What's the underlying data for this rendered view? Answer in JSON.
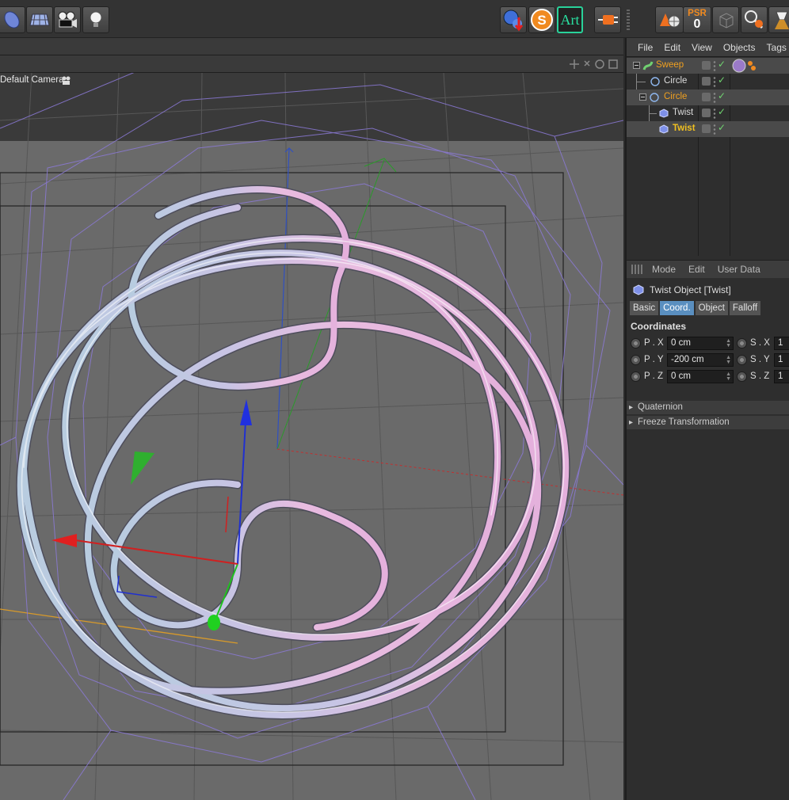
{
  "viewport": {
    "camera_label": "Default Camera"
  },
  "toolbar": {
    "psr_label": "PSR",
    "psr_value": "0",
    "art_label": "Art",
    "s_label": "S"
  },
  "object_manager": {
    "menu": [
      "File",
      "Edit",
      "View",
      "Objects",
      "Tags"
    ],
    "objects": [
      {
        "name": "Sweep",
        "color": "#f0a020",
        "indent": 0
      },
      {
        "name": "Circle",
        "color": "#dcdcdc",
        "indent": 1
      },
      {
        "name": "Circle",
        "color": "#f0a020",
        "indent": 1
      },
      {
        "name": "Twist",
        "color": "#dcdcdc",
        "indent": 2
      },
      {
        "name": "Twist",
        "color": "#f0c020",
        "indent": 2
      }
    ]
  },
  "attribute_manager": {
    "menu": [
      "Mode",
      "Edit",
      "User Data"
    ],
    "title": "Twist Object [Twist]",
    "tabs": [
      "Basic",
      "Coord.",
      "Object",
      "Falloff"
    ],
    "active_tab": "Coord.",
    "section": "Coordinates",
    "coords": [
      {
        "p_label": "P . X",
        "p_value": "0 cm",
        "s_label": "S . X",
        "s_value": "1"
      },
      {
        "p_label": "P . Y",
        "p_value": "-200 cm",
        "s_label": "S . Y",
        "s_value": "1"
      },
      {
        "p_label": "P . Z",
        "p_value": "0 cm",
        "s_label": "S . Z",
        "s_value": "1"
      }
    ],
    "groups": [
      "Quaternion",
      "Freeze Transformation"
    ]
  }
}
